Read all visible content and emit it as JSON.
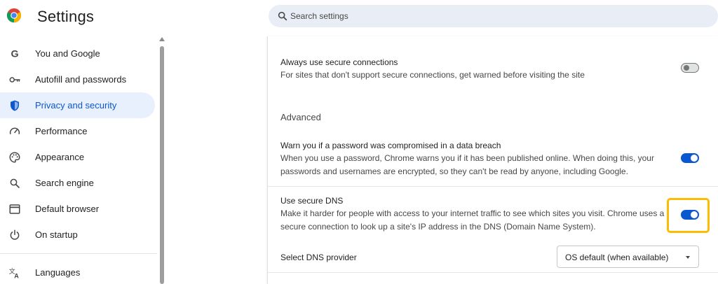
{
  "header": {
    "title": "Settings",
    "search_placeholder": "Search settings"
  },
  "sidebar": {
    "items": [
      {
        "label": "You and Google",
        "icon": "google-g-icon"
      },
      {
        "label": "Autofill and passwords",
        "icon": "key-icon"
      },
      {
        "label": "Privacy and security",
        "icon": "shield-icon",
        "active": true
      },
      {
        "label": "Performance",
        "icon": "speedometer-icon"
      },
      {
        "label": "Appearance",
        "icon": "palette-icon"
      },
      {
        "label": "Search engine",
        "icon": "search-icon"
      },
      {
        "label": "Default browser",
        "icon": "browser-window-icon"
      },
      {
        "label": "On startup",
        "icon": "power-icon"
      },
      {
        "label": "Languages",
        "icon": "translate-icon"
      }
    ]
  },
  "main": {
    "secure_connections": {
      "title": "Always use secure connections",
      "subtitle": "For sites that don't support secure connections, get warned before visiting the site",
      "enabled": false
    },
    "advanced_heading": "Advanced",
    "password_warning": {
      "title": "Warn you if a password was compromised in a data breach",
      "subtitle": "When you use a password, Chrome warns you if it has been published online. When doing this, your passwords and usernames are encrypted, so they can't be read by anyone, including Google.",
      "enabled": true
    },
    "secure_dns": {
      "title": "Use secure DNS",
      "subtitle": "Make it harder for people with access to your internet traffic to see which sites you visit. Chrome uses a secure connection to look up a site's IP address in the DNS (Domain Name System).",
      "enabled": true
    },
    "dns_provider": {
      "label": "Select DNS provider",
      "selected": "OS default (when available)"
    }
  },
  "colors": {
    "accent": "#0b57d0",
    "active_nav_bg": "#e8effd",
    "search_bg": "#e9eef6",
    "highlight": "#fbbc04"
  }
}
